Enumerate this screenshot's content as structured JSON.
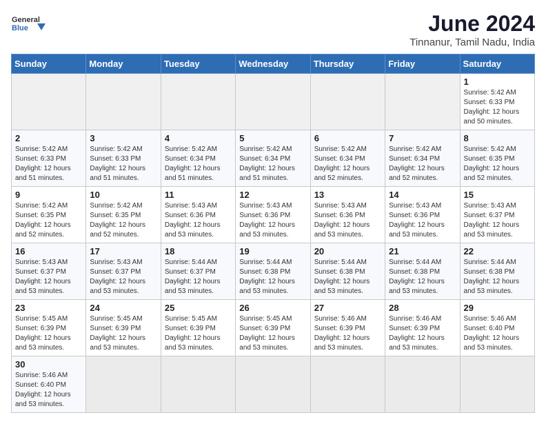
{
  "header": {
    "logo_general": "General",
    "logo_blue": "Blue",
    "title": "June 2024",
    "subtitle": "Tinnanur, Tamil Nadu, India"
  },
  "weekdays": [
    "Sunday",
    "Monday",
    "Tuesday",
    "Wednesday",
    "Thursday",
    "Friday",
    "Saturday"
  ],
  "weeks": [
    [
      {
        "day": "",
        "info": ""
      },
      {
        "day": "",
        "info": ""
      },
      {
        "day": "",
        "info": ""
      },
      {
        "day": "",
        "info": ""
      },
      {
        "day": "",
        "info": ""
      },
      {
        "day": "",
        "info": ""
      },
      {
        "day": "1",
        "info": "Sunrise: 5:42 AM\nSunset: 6:33 PM\nDaylight: 12 hours\nand 50 minutes."
      }
    ],
    [
      {
        "day": "2",
        "info": "Sunrise: 5:42 AM\nSunset: 6:33 PM\nDaylight: 12 hours\nand 51 minutes."
      },
      {
        "day": "3",
        "info": "Sunrise: 5:42 AM\nSunset: 6:33 PM\nDaylight: 12 hours\nand 51 minutes."
      },
      {
        "day": "4",
        "info": "Sunrise: 5:42 AM\nSunset: 6:34 PM\nDaylight: 12 hours\nand 51 minutes."
      },
      {
        "day": "5",
        "info": "Sunrise: 5:42 AM\nSunset: 6:34 PM\nDaylight: 12 hours\nand 51 minutes."
      },
      {
        "day": "6",
        "info": "Sunrise: 5:42 AM\nSunset: 6:34 PM\nDaylight: 12 hours\nand 52 minutes."
      },
      {
        "day": "7",
        "info": "Sunrise: 5:42 AM\nSunset: 6:34 PM\nDaylight: 12 hours\nand 52 minutes."
      },
      {
        "day": "8",
        "info": "Sunrise: 5:42 AM\nSunset: 6:35 PM\nDaylight: 12 hours\nand 52 minutes."
      }
    ],
    [
      {
        "day": "9",
        "info": "Sunrise: 5:42 AM\nSunset: 6:35 PM\nDaylight: 12 hours\nand 52 minutes."
      },
      {
        "day": "10",
        "info": "Sunrise: 5:42 AM\nSunset: 6:35 PM\nDaylight: 12 hours\nand 52 minutes."
      },
      {
        "day": "11",
        "info": "Sunrise: 5:43 AM\nSunset: 6:36 PM\nDaylight: 12 hours\nand 53 minutes."
      },
      {
        "day": "12",
        "info": "Sunrise: 5:43 AM\nSunset: 6:36 PM\nDaylight: 12 hours\nand 53 minutes."
      },
      {
        "day": "13",
        "info": "Sunrise: 5:43 AM\nSunset: 6:36 PM\nDaylight: 12 hours\nand 53 minutes."
      },
      {
        "day": "14",
        "info": "Sunrise: 5:43 AM\nSunset: 6:36 PM\nDaylight: 12 hours\nand 53 minutes."
      },
      {
        "day": "15",
        "info": "Sunrise: 5:43 AM\nSunset: 6:37 PM\nDaylight: 12 hours\nand 53 minutes."
      }
    ],
    [
      {
        "day": "16",
        "info": "Sunrise: 5:43 AM\nSunset: 6:37 PM\nDaylight: 12 hours\nand 53 minutes."
      },
      {
        "day": "17",
        "info": "Sunrise: 5:43 AM\nSunset: 6:37 PM\nDaylight: 12 hours\nand 53 minutes."
      },
      {
        "day": "18",
        "info": "Sunrise: 5:44 AM\nSunset: 6:37 PM\nDaylight: 12 hours\nand 53 minutes."
      },
      {
        "day": "19",
        "info": "Sunrise: 5:44 AM\nSunset: 6:38 PM\nDaylight: 12 hours\nand 53 minutes."
      },
      {
        "day": "20",
        "info": "Sunrise: 5:44 AM\nSunset: 6:38 PM\nDaylight: 12 hours\nand 53 minutes."
      },
      {
        "day": "21",
        "info": "Sunrise: 5:44 AM\nSunset: 6:38 PM\nDaylight: 12 hours\nand 53 minutes."
      },
      {
        "day": "22",
        "info": "Sunrise: 5:44 AM\nSunset: 6:38 PM\nDaylight: 12 hours\nand 53 minutes."
      }
    ],
    [
      {
        "day": "23",
        "info": "Sunrise: 5:45 AM\nSunset: 6:39 PM\nDaylight: 12 hours\nand 53 minutes."
      },
      {
        "day": "24",
        "info": "Sunrise: 5:45 AM\nSunset: 6:39 PM\nDaylight: 12 hours\nand 53 minutes."
      },
      {
        "day": "25",
        "info": "Sunrise: 5:45 AM\nSunset: 6:39 PM\nDaylight: 12 hours\nand 53 minutes."
      },
      {
        "day": "26",
        "info": "Sunrise: 5:45 AM\nSunset: 6:39 PM\nDaylight: 12 hours\nand 53 minutes."
      },
      {
        "day": "27",
        "info": "Sunrise: 5:46 AM\nSunset: 6:39 PM\nDaylight: 12 hours\nand 53 minutes."
      },
      {
        "day": "28",
        "info": "Sunrise: 5:46 AM\nSunset: 6:39 PM\nDaylight: 12 hours\nand 53 minutes."
      },
      {
        "day": "29",
        "info": "Sunrise: 5:46 AM\nSunset: 6:40 PM\nDaylight: 12 hours\nand 53 minutes."
      }
    ],
    [
      {
        "day": "30",
        "info": "Sunrise: 5:46 AM\nSunset: 6:40 PM\nDaylight: 12 hours\nand 53 minutes."
      },
      {
        "day": "",
        "info": ""
      },
      {
        "day": "",
        "info": ""
      },
      {
        "day": "",
        "info": ""
      },
      {
        "day": "",
        "info": ""
      },
      {
        "day": "",
        "info": ""
      },
      {
        "day": "",
        "info": ""
      }
    ]
  ]
}
